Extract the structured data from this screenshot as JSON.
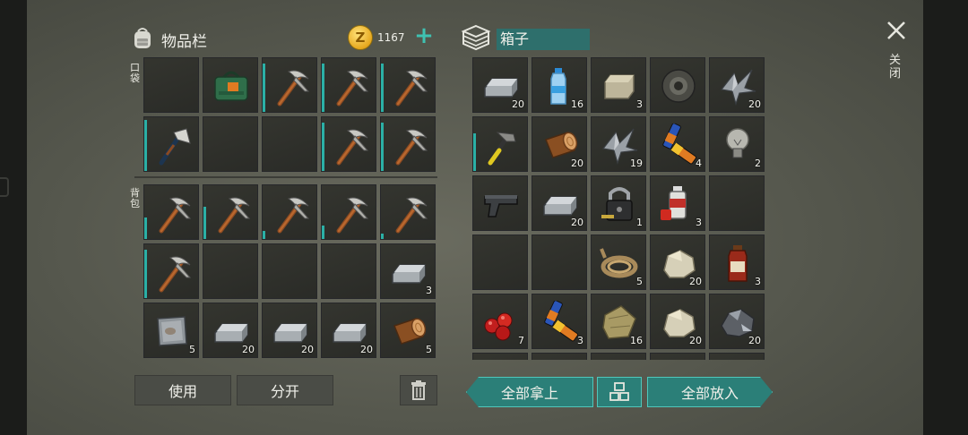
{
  "inventory": {
    "title": "物品栏",
    "currency_amount": "1167",
    "pocket_label": "口袋",
    "backpack_label": "背包",
    "pocket_slots": [
      {
        "icon": "empty"
      },
      {
        "icon": "green-bag-icon"
      },
      {
        "icon": "pickaxe-icon",
        "durability": 0.9
      },
      {
        "icon": "pickaxe-icon",
        "durability": 0.9
      },
      {
        "icon": "pickaxe-icon",
        "durability": 0.9
      },
      {
        "icon": "hatchet-icon",
        "durability": 0.95
      },
      {
        "icon": "empty"
      },
      {
        "icon": "empty"
      },
      {
        "icon": "pickaxe-icon",
        "durability": 0.9
      },
      {
        "icon": "pickaxe-icon",
        "durability": 0.9
      }
    ],
    "backpack_slots": [
      {
        "icon": "pickaxe-icon",
        "durability": 0.4
      },
      {
        "icon": "pickaxe-icon",
        "durability": 0.6
      },
      {
        "icon": "pickaxe-icon",
        "durability": 0.15
      },
      {
        "icon": "pickaxe-icon",
        "durability": 0.25
      },
      {
        "icon": "pickaxe-icon",
        "durability": 0.1
      },
      {
        "icon": "pickaxe-icon",
        "durability": 0.9
      },
      {
        "icon": "empty"
      },
      {
        "icon": "empty"
      },
      {
        "icon": "empty"
      },
      {
        "icon": "iron-ingot-icon",
        "qty": "3"
      },
      {
        "icon": "metal-plate-icon",
        "qty": "5"
      },
      {
        "icon": "iron-ingot-icon",
        "qty": "20"
      },
      {
        "icon": "iron-ingot-icon",
        "qty": "20"
      },
      {
        "icon": "iron-ingot-icon",
        "qty": "20"
      },
      {
        "icon": "log-icon",
        "qty": "5"
      }
    ],
    "use_label": "使用",
    "split_label": "分开"
  },
  "box": {
    "title": "箱子",
    "slots": [
      {
        "icon": "iron-ingot-icon",
        "qty": "20"
      },
      {
        "icon": "water-bottle-icon",
        "qty": "16"
      },
      {
        "icon": "stone-block-icon",
        "qty": "3"
      },
      {
        "icon": "tape-roll-icon"
      },
      {
        "icon": "scrap-metal-icon",
        "qty": "20"
      },
      {
        "icon": "hammer-icon",
        "durability": 0.7
      },
      {
        "icon": "log-icon",
        "qty": "20"
      },
      {
        "icon": "scrap-metal-icon",
        "qty": "19"
      },
      {
        "icon": "battery-icon",
        "qty": "4"
      },
      {
        "icon": "light-bulb-icon",
        "qty": "2"
      },
      {
        "icon": "pistol-icon"
      },
      {
        "icon": "iron-ingot-icon",
        "qty": "20"
      },
      {
        "icon": "padlock-icon",
        "qty": "1"
      },
      {
        "icon": "spray-can-icon",
        "qty": "3"
      },
      {
        "icon": "empty"
      },
      {
        "icon": "empty"
      },
      {
        "icon": "empty"
      },
      {
        "icon": "rope-icon",
        "qty": "5"
      },
      {
        "icon": "stone-icon",
        "qty": "20"
      },
      {
        "icon": "medicine-bottle-icon",
        "qty": "3"
      },
      {
        "icon": "berries-icon",
        "qty": "7"
      },
      {
        "icon": "battery-icon",
        "qty": "3"
      },
      {
        "icon": "cloth-icon",
        "qty": "16"
      },
      {
        "icon": "stone-icon",
        "qty": "20"
      },
      {
        "icon": "iron-ore-icon",
        "qty": "20"
      }
    ],
    "take_all_label": "全部拿上",
    "put_all_label": "全部放入"
  },
  "close_label": "关闭",
  "colors": {
    "accent": "#2b7f78",
    "accent_border": "#4fc7bb",
    "durability": "#2bb0a6"
  }
}
